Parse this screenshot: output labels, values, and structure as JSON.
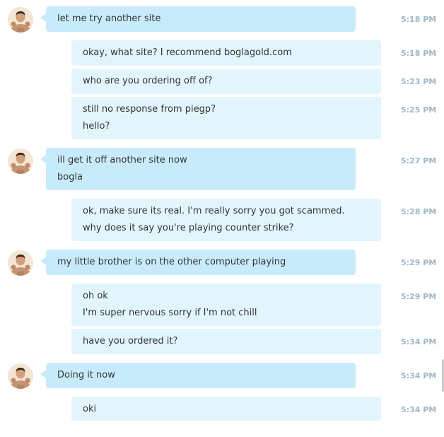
{
  "messages": [
    {
      "side": "in",
      "lines": [
        "let me try another site"
      ],
      "time": "5:18 PM"
    },
    {
      "side": "out",
      "lines": [
        "okay, what site? I recommend boglagold.com"
      ],
      "time": "5:18 PM"
    },
    {
      "side": "out",
      "lines": [
        "who are you ordering off of?"
      ],
      "time": "5:23 PM"
    },
    {
      "side": "out",
      "lines": [
        "still no response from piegp?",
        "hello?"
      ],
      "time": "5:25 PM"
    },
    {
      "side": "in",
      "lines": [
        "ill get it off another site now",
        "bogla"
      ],
      "time": "5:27 PM"
    },
    {
      "side": "out",
      "lines": [
        "ok, make sure its real. I'm really sorry you got scammed.",
        "why does it say you're playing counter strike?"
      ],
      "time": "5:28 PM"
    },
    {
      "side": "in",
      "lines": [
        "my little brother is on the other computer playing"
      ],
      "time": "5:29 PM"
    },
    {
      "side": "out",
      "lines": [
        "oh ok",
        "I'm super nervous sorry if I'm not chill"
      ],
      "time": "5:29 PM"
    },
    {
      "side": "out",
      "lines": [
        "have you ordered it?"
      ],
      "time": "5:34 PM"
    },
    {
      "side": "in",
      "lines": [
        "Doing it now"
      ],
      "time": "5:34 PM"
    },
    {
      "side": "out",
      "lines": [
        "oki"
      ],
      "time": "5:34 PM"
    }
  ],
  "avatar_icon": "user-avatar-icon",
  "colors": {
    "incoming_bubble": "#c8ebfb",
    "outgoing_bubble": "#e2f5fd",
    "timestamp": "#9fb7c6",
    "text": "#333333"
  }
}
